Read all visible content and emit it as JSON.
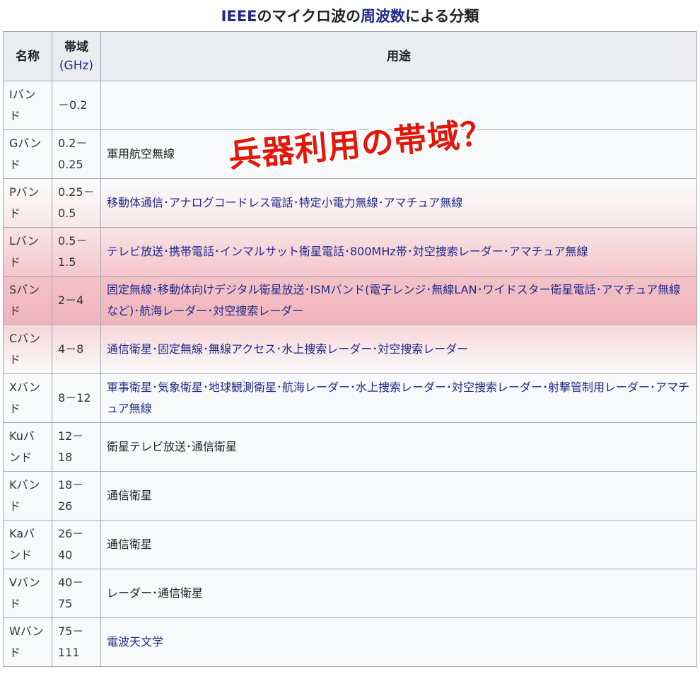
{
  "caption": {
    "part1": "IEEE",
    "part2": "のマイクロ波の",
    "part3": "周波数",
    "part4": "による分類"
  },
  "header": {
    "name": "名称",
    "freq_line1": "帯域",
    "freq_line2": "(GHz)",
    "use": "用途"
  },
  "rows": [
    {
      "name": "Iバンド",
      "freq": "－0.2",
      "use": ""
    },
    {
      "name": "Gバンド",
      "freq": "0.2－0.25",
      "use": "軍用航空無線"
    },
    {
      "name": "Pバンド",
      "freq": "0.25－0.5",
      "use": "移動体通信･アナログコードレス電話･特定小電力無線･アマチュア無線"
    },
    {
      "name": "Lバンド",
      "freq": "0.5－1.5",
      "use": "テレビ放送･携帯電話･インマルサット衛星電話･800MHz帯･対空捜索レーダー･アマチュア無線"
    },
    {
      "name": "Sバンド",
      "freq": "2－4",
      "use": "固定無線･移動体向けデジタル衛星放送･ISMバンド(電子レンジ･無線LAN･ワイドスター衛星電話･アマチュア無線など)･航海レーダー･対空捜索レーダー"
    },
    {
      "name": "Cバンド",
      "freq": "4－8",
      "use": "通信衛星･固定無線･無線アクセス･水上捜索レーダー･対空捜索レーダー"
    },
    {
      "name": "Xバンド",
      "freq": "8－12",
      "use": "軍事衛星･気象衛星･地球観測衛星･航海レーダー･水上捜索レーダー･対空捜索レーダー･射撃管制用レーダー･アマチュア無線"
    },
    {
      "name": "Kuバンド",
      "freq": "12－18",
      "use": "衛星テレビ放送･通信衛星"
    },
    {
      "name": "Kバンド",
      "freq": "18－26",
      "use": "通信衛星"
    },
    {
      "name": "Kaバンド",
      "freq": "26－40",
      "use": "通信衛星"
    },
    {
      "name": "Vバンド",
      "freq": "40－75",
      "use": "レーダー･通信衛星"
    },
    {
      "name": "Wバンド",
      "freq": "75－111",
      "use": "電波天文学"
    }
  ],
  "overlay_text": "兵器利用の帯域？",
  "colors": {
    "link": "#202a8a",
    "overlay": "#e3160a",
    "highlight": "#f4c6cc"
  }
}
